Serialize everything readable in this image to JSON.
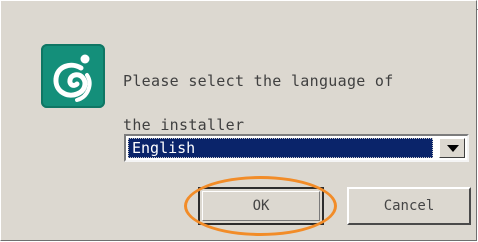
{
  "dialog": {
    "logo_icon": "installer-logo-icon",
    "prompt_line1": "Please select the language of",
    "prompt_line2": "the installer",
    "language_select": {
      "selected": "English",
      "arrow_icon": "chevron-down-icon"
    },
    "ok_label": "OK",
    "cancel_label": "Cancel"
  },
  "annotation": {
    "highlight_color": "#f28c28"
  },
  "colors": {
    "dialog_bg": "#dcd8d0",
    "logo_bg": "#148f7a",
    "selection_bg": "#0a246a"
  }
}
